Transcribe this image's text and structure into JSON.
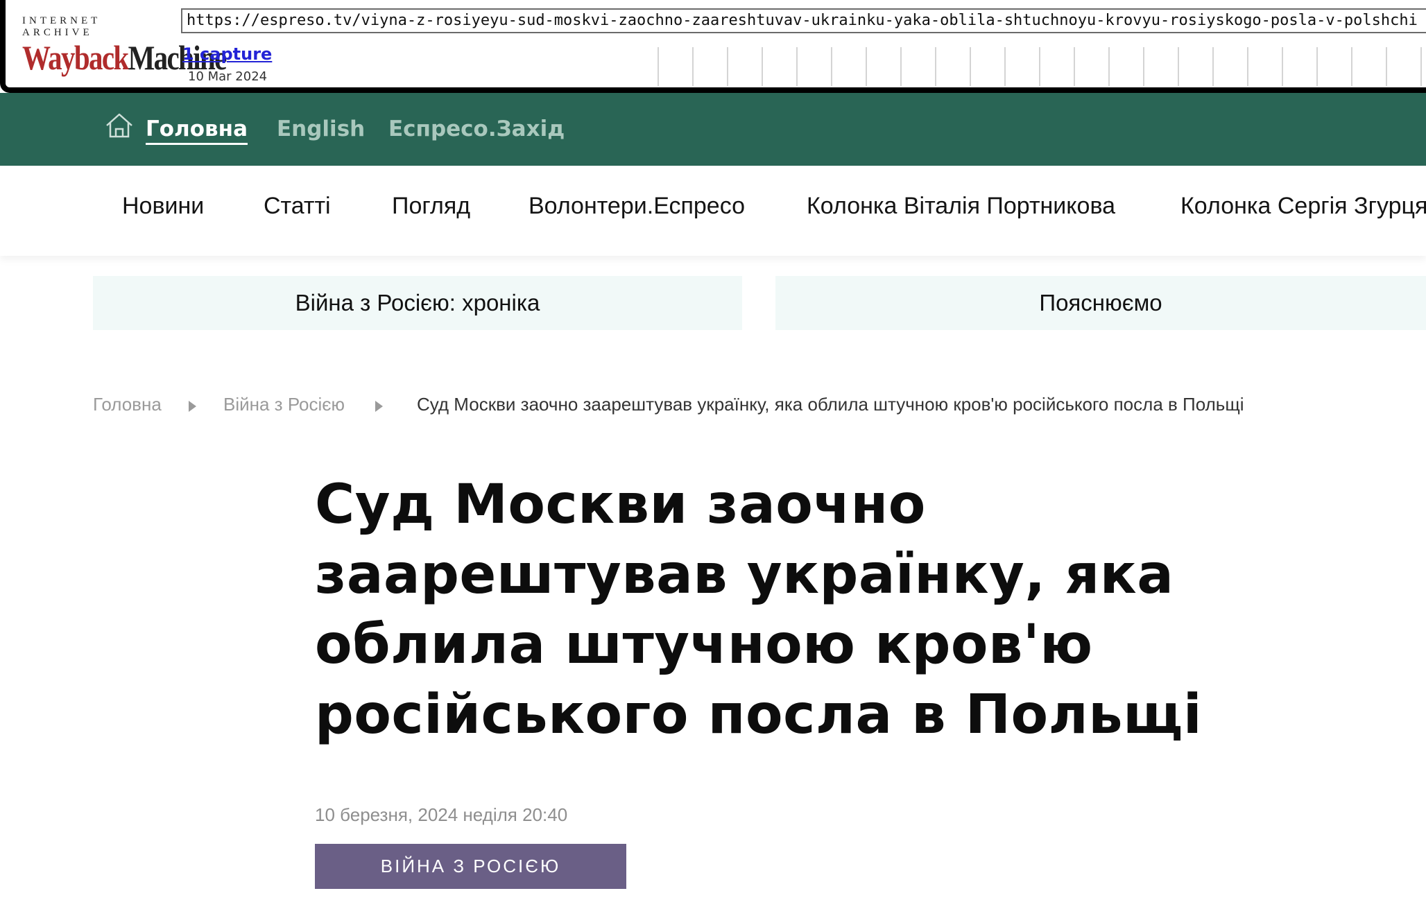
{
  "wayback": {
    "logo_top": "INTERNET ARCHIVE",
    "logo_wayback": "Wayback",
    "logo_machine": "Machine",
    "url": "https://espreso.tv/viyna-z-rosiyeyu-sud-moskvi-zaochno-zaareshtuvav-ukrainku-yaka-oblila-shtuchnoyu-krovyu-rosiyskogo-posla-v-polshchi",
    "captures": "1 capture",
    "date": "10 Mar 2024"
  },
  "topnav": {
    "home": "Головна",
    "english": "English",
    "west": "Еспресо.Захід"
  },
  "menu": [
    "Новини",
    "Статті",
    "Погляд",
    "Волонтери.Еспресо",
    "Колонка Віталія Портникова",
    "Колонка Сергія Згурця"
  ],
  "features": [
    "Війна з Росією: хроніка",
    "Пояснюємо"
  ],
  "breadcrumb": {
    "home": "Головна",
    "section": "Війна з Росією",
    "current": "Суд Москви заочно заарештував українку, яка облила штучною кров'ю російського посла в Польщі"
  },
  "article": {
    "title_lines": [
      "Суд Москви заочно",
      "заарештував українку, яка",
      "облила штучною кров'ю",
      "російського посла в Польщі"
    ],
    "date": "10 березня, 2024 неділя  20:40",
    "tag": "ВІЙНА З РОСІЄЮ"
  },
  "colors": {
    "topnav_bg": "#296555",
    "feature_bg": "#f1f9f8",
    "tag_bg": "#6a5f86"
  }
}
